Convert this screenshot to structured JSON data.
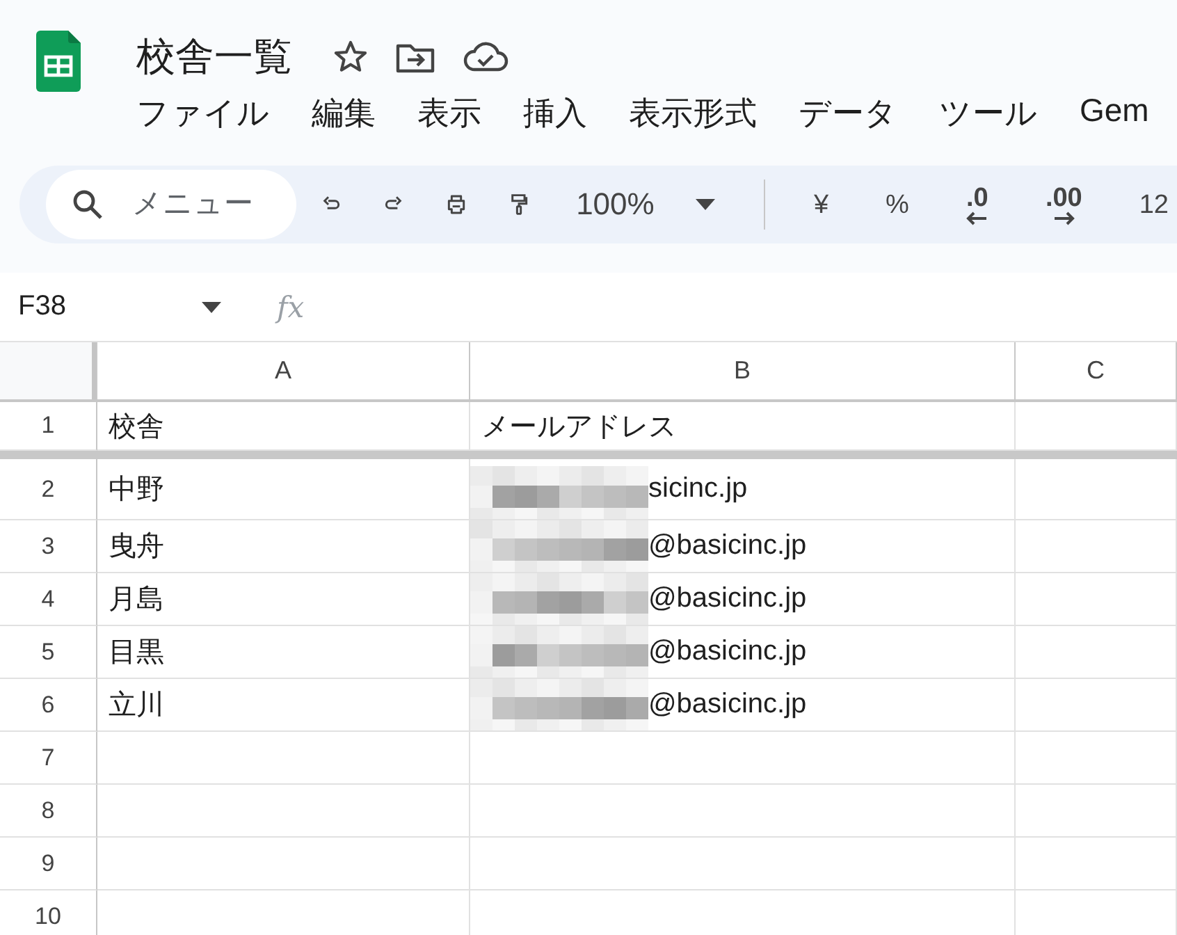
{
  "document": {
    "title": "校舎一覧",
    "starred": false
  },
  "menu": [
    "ファイル",
    "編集",
    "表示",
    "挿入",
    "表示形式",
    "データ",
    "ツール",
    "Gem"
  ],
  "toolbar": {
    "search": {
      "placeholder": "メニュー"
    },
    "zoom": "100%",
    "format_buttons": [
      {
        "kind": "text",
        "label": "¥"
      },
      {
        "kind": "text",
        "label": "%"
      },
      {
        "kind": "decrease",
        "label": ".0"
      },
      {
        "kind": "increase",
        "label": ".00"
      },
      {
        "kind": "text",
        "label": "12"
      }
    ]
  },
  "formula_bar": {
    "cell_ref": "F38",
    "fx": "fx"
  },
  "sheet": {
    "columns": [
      "A",
      "B",
      "C"
    ],
    "rows": [
      {
        "number": "1",
        "cells": [
          {
            "text": "校舎"
          },
          {
            "text": "メールアドレス"
          }
        ],
        "frozen": true
      },
      {
        "number": "2",
        "cells": [
          {
            "text": "中野"
          },
          {
            "text": "sicinc.jp",
            "redacted": true
          }
        ],
        "frozen": false
      },
      {
        "number": "3",
        "cells": [
          {
            "text": "曳舟"
          },
          {
            "text": "@basicinc.jp",
            "redacted": true
          }
        ],
        "frozen": false
      },
      {
        "number": "4",
        "cells": [
          {
            "text": "月島"
          },
          {
            "text": "@basicinc.jp",
            "redacted": true
          }
        ],
        "frozen": false
      },
      {
        "number": "5",
        "cells": [
          {
            "text": "目黒"
          },
          {
            "text": "@basicinc.jp",
            "redacted": true
          }
        ],
        "frozen": false
      },
      {
        "number": "6",
        "cells": [
          {
            "text": "立川"
          },
          {
            "text": "@basicinc.jp",
            "redacted": true
          }
        ],
        "frozen": false
      },
      {
        "number": "7",
        "cells": [],
        "frozen": false
      },
      {
        "number": "8",
        "cells": [],
        "frozen": false
      },
      {
        "number": "9",
        "cells": [],
        "frozen": false
      },
      {
        "number": "10",
        "cells": [],
        "frozen": false
      }
    ]
  }
}
